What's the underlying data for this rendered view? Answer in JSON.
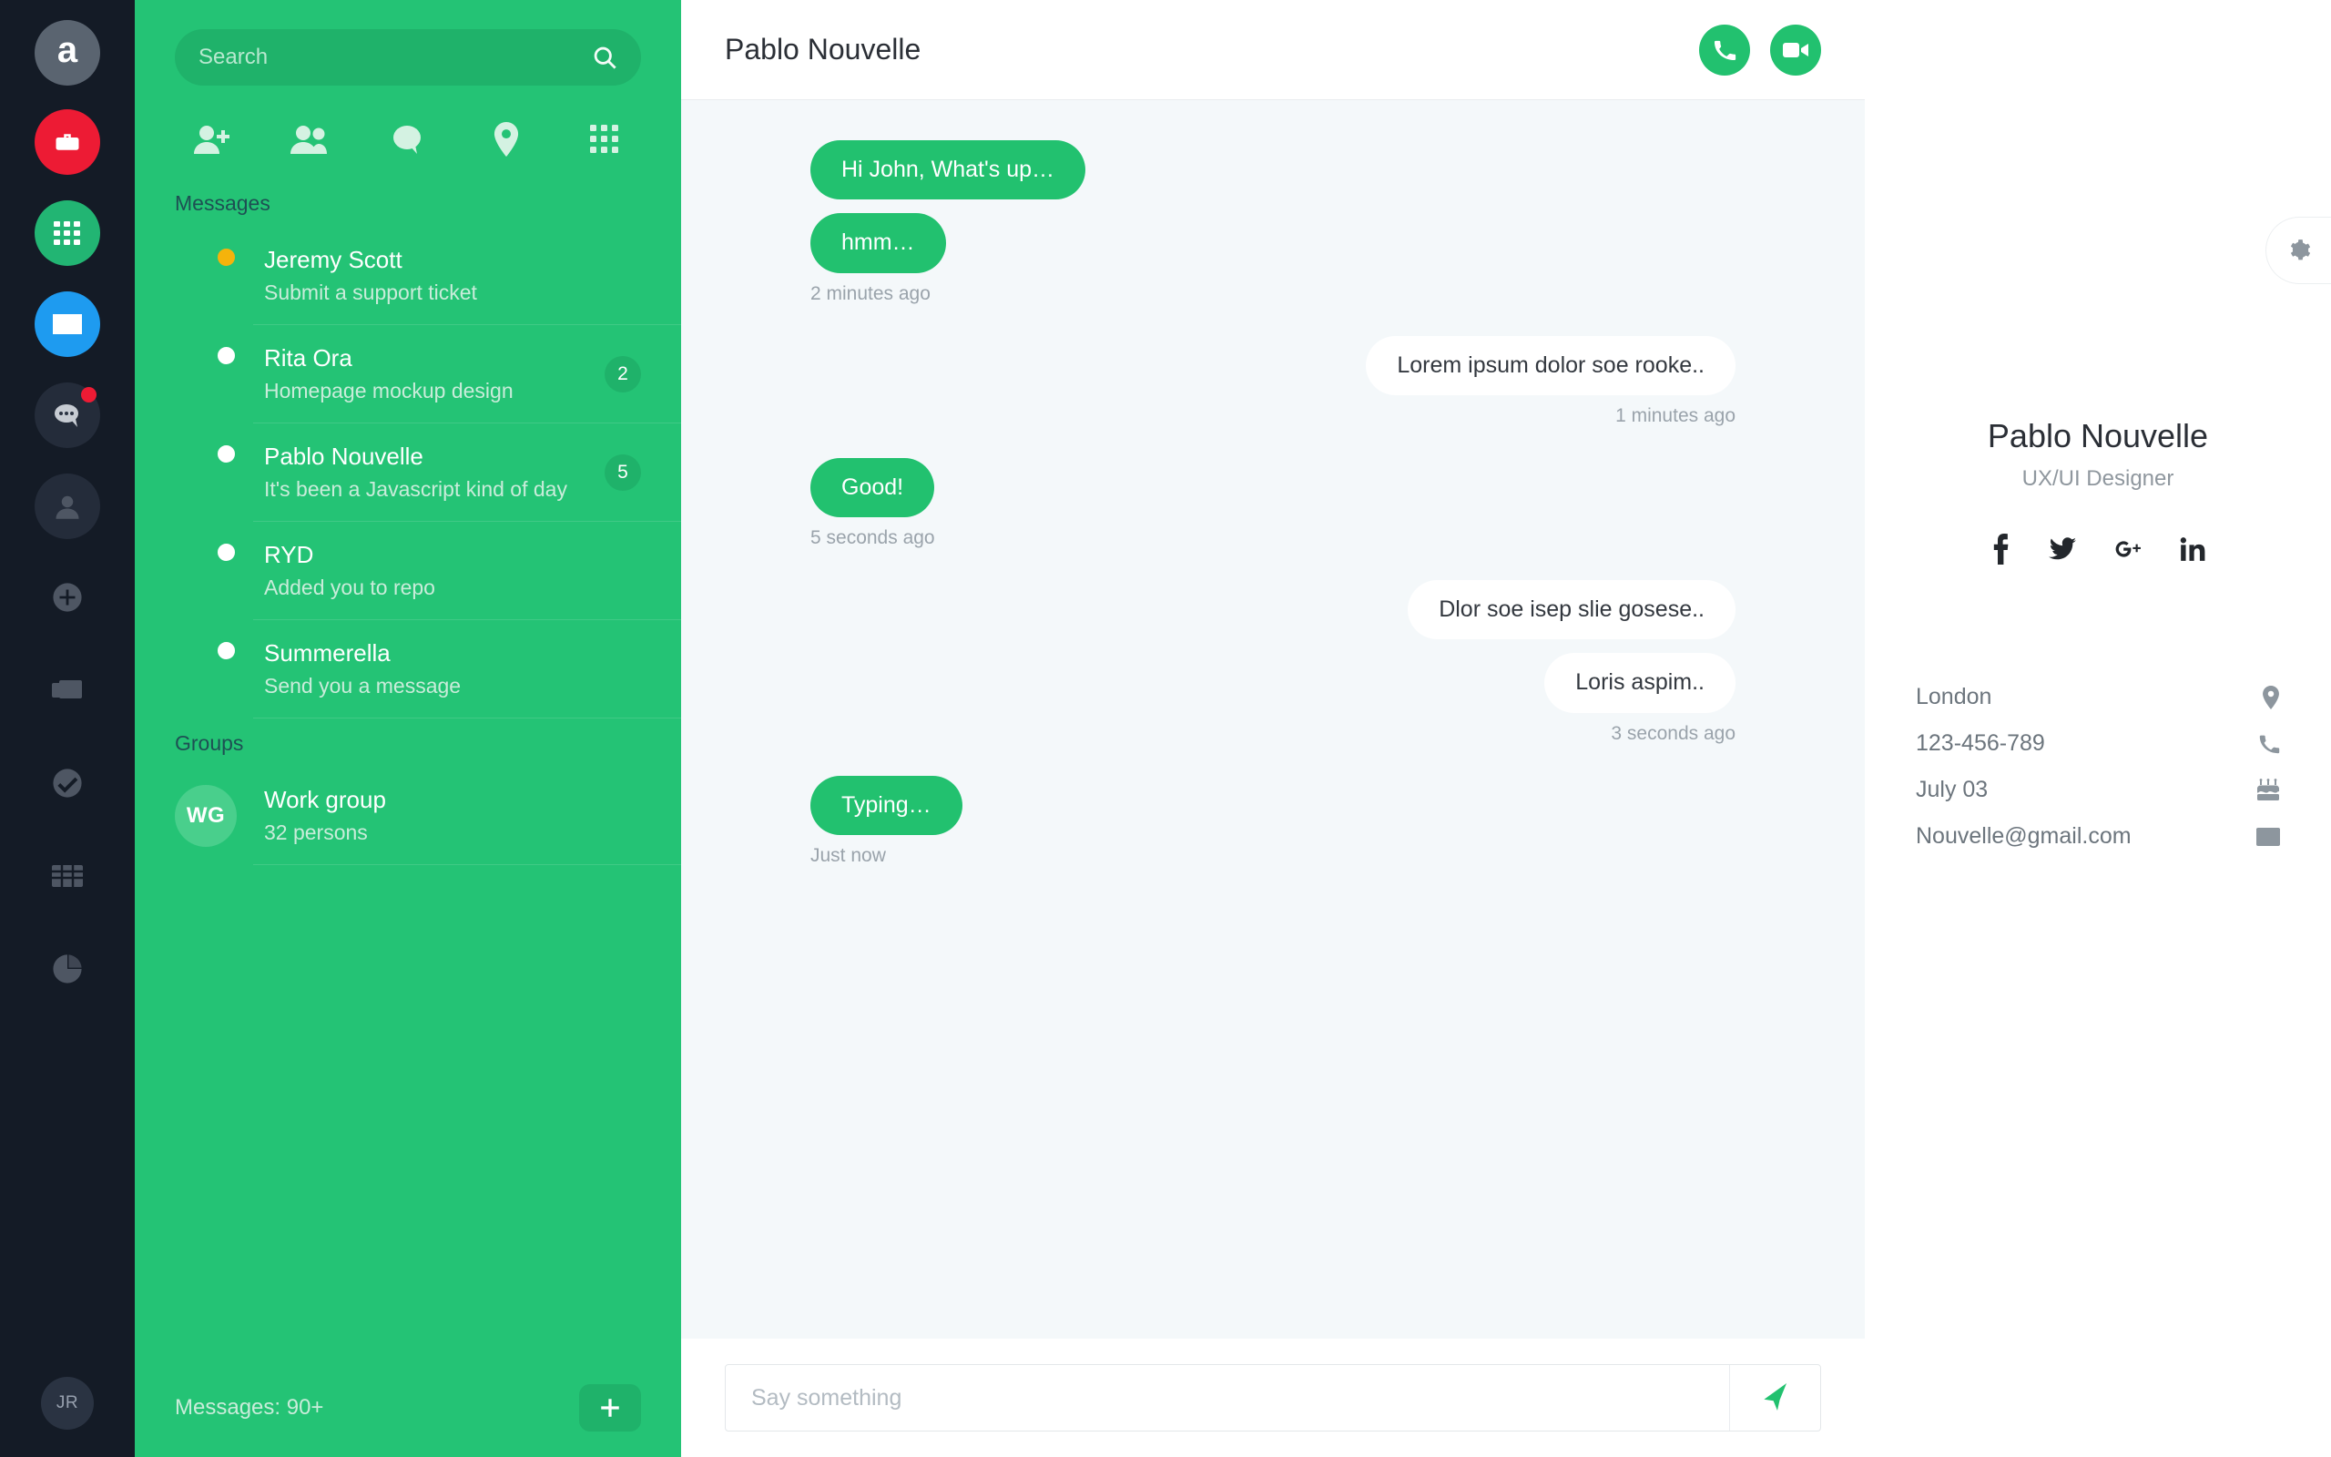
{
  "rail": {
    "logo_label": "a",
    "items": [
      {
        "name": "briefcase-icon",
        "color": "#ed1b34"
      },
      {
        "name": "grid-apps-icon",
        "color": "#22b573"
      },
      {
        "name": "mail-icon",
        "color": "#1e9bf0"
      },
      {
        "name": "chat-icon",
        "color": "#242c3a",
        "badge": true
      },
      {
        "name": "user-icon",
        "color": "#242c3a"
      },
      {
        "name": "plus-circle-icon",
        "color": "transparent"
      },
      {
        "name": "layers-icon",
        "color": "transparent"
      },
      {
        "name": "check-circle-icon",
        "color": "transparent"
      },
      {
        "name": "table-icon",
        "color": "transparent"
      },
      {
        "name": "pie-chart-icon",
        "color": "transparent"
      }
    ],
    "user_initials": "JR"
  },
  "panel": {
    "search": {
      "placeholder": "Search",
      "value": ""
    },
    "nav_icons": [
      "add-user-icon",
      "users-icon",
      "chat-bubble-icon",
      "location-pin-icon",
      "grid-dots-icon"
    ],
    "messages_label": "Messages",
    "groups_label": "Groups",
    "conversations": [
      {
        "name": "Jeremy Scott",
        "preview": "Submit a support ticket",
        "status": "away",
        "badge": ""
      },
      {
        "name": "Rita Ora",
        "preview": "Homepage mockup design",
        "status": "online",
        "badge": "2"
      },
      {
        "name": "Pablo Nouvelle",
        "preview": "It's been a Javascript kind of day",
        "status": "online",
        "badge": "5"
      },
      {
        "name": "RYD",
        "preview": "Added you to repo",
        "status": "online",
        "badge": ""
      },
      {
        "name": "Summerella",
        "preview": "Send you a message",
        "status": "online",
        "badge": ""
      }
    ],
    "groups": [
      {
        "initials": "WG",
        "name": "Work group",
        "sub": "32 persons"
      }
    ],
    "footer_count": "Messages: 90+",
    "add_button": "add-conversation-button"
  },
  "chat": {
    "title": "Pablo Nouvelle",
    "call_button": "phone-call-icon",
    "video_button": "video-call-icon",
    "groups": [
      {
        "side": "in",
        "bubbles": [
          "Hi John, What's up…",
          "hmm…"
        ],
        "time": "2 minutes ago"
      },
      {
        "side": "out",
        "bubbles": [
          "Lorem ipsum dolor soe rooke.."
        ],
        "time": "1 minutes ago"
      },
      {
        "side": "in",
        "bubbles": [
          "Good!"
        ],
        "time": "5 seconds ago"
      },
      {
        "side": "out",
        "bubbles": [
          "Dlor soe isep slie gosese..",
          "Loris aspim.."
        ],
        "time": "3 seconds ago"
      },
      {
        "side": "in",
        "bubbles": [
          "Typing…"
        ],
        "time": "Just now"
      }
    ],
    "composer": {
      "placeholder": "Say something",
      "value": "",
      "send": "send-icon"
    }
  },
  "profile": {
    "settings_icon": "gear-icon",
    "name": "Pablo Nouvelle",
    "role": "UX/UI Designer",
    "socials": [
      "facebook-icon",
      "twitter-icon",
      "google-plus-icon",
      "linkedin-icon"
    ],
    "info": [
      {
        "text": "London",
        "icon": "map-pin-icon"
      },
      {
        "text": "123-456-789",
        "icon": "phone-icon"
      },
      {
        "text": "July 03",
        "icon": "birthday-cake-icon"
      },
      {
        "text": "Nouvelle@gmail.com",
        "icon": "envelope-icon"
      }
    ]
  },
  "colors": {
    "rail_bg": "#141b26",
    "panel_green": "#24c375",
    "accent_green": "#22c16f",
    "thread_bg": "#f4f8fa"
  }
}
